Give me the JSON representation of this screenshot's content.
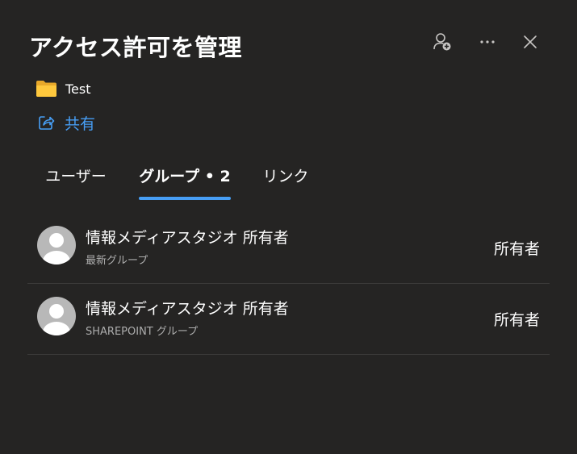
{
  "panel": {
    "title": "アクセス許可を管理",
    "actions": {
      "add_person_icon": "person-add-icon",
      "more_icon": "more-horizontal-icon",
      "close_icon": "close-icon"
    }
  },
  "item": {
    "icon": "folder-icon",
    "name": "Test"
  },
  "share": {
    "icon": "share-icon",
    "label": "共有"
  },
  "tabs": [
    {
      "label": "ユーザー",
      "active": false
    },
    {
      "label": "グループ • 2",
      "active": true
    },
    {
      "label": "リンク",
      "active": false
    }
  ],
  "groups": [
    {
      "name": "情報メディアスタジオ 所有者",
      "subtitle": "最新グループ",
      "role": "所有者",
      "avatar_icon": "person-avatar-icon"
    },
    {
      "name": "情報メディアスタジオ 所有者",
      "subtitle": "SHAREPOINT グループ",
      "role": "所有者",
      "avatar_icon": "person-avatar-icon"
    }
  ],
  "colors": {
    "background": "#252423",
    "accent": "#479ef5",
    "divider": "#3b3a39",
    "secondary_text": "#adadad",
    "folder": "#f2b832"
  }
}
